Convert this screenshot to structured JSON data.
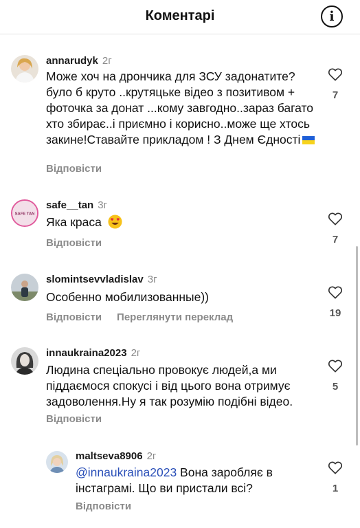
{
  "header": {
    "title": "Коментарі",
    "info_icon": "info-icon"
  },
  "comments": [
    {
      "user": "annarudyk",
      "time": "2г",
      "text": "Може хоч на дрончика для ЗСУ задонатите? було б круто ..крутяцьке відео з позитивом + фоточка за донат ...кому завгодно..зараз багато хто збирає..і приємно і корисно..може ще хтось закине!Ставайте прикладом ! З Днем Єдності",
      "emoji": "ukraine-flag",
      "reply_label": "Відповісти",
      "likes": "7"
    },
    {
      "user": "safe__tan",
      "time": "3г",
      "avatar_text": "SAFE TAN",
      "text": "Яка краса",
      "emoji": "heart-eyes",
      "reply_label": "Відповісти",
      "likes": "7"
    },
    {
      "user": "slomintsevvladislav",
      "time": "3г",
      "text": "Особенно мобилизованные))",
      "reply_label": "Відповісти",
      "translate_label": "Переглянути переклад",
      "likes": "19"
    },
    {
      "user": "innaukraina2023",
      "time": "2г",
      "text": "Людина спеціально провокує людей,а ми піддаємося спокусі  і від цього вона отримує задоволення.Ну я так розумію подібні відео.",
      "reply_label": "Відповісти",
      "likes": "5"
    }
  ],
  "reply": {
    "user": "maltseva8906",
    "time": "2г",
    "mention": "@innaukraina2023",
    "text": " Вона заробляє в інстаграмі. Що ви пристали всі?",
    "reply_label": "Відповісти",
    "likes": "1"
  },
  "colors": {
    "mention": "#2a4fb8",
    "muted": "#8a8a8a",
    "flag_blue": "#1f5fd6",
    "flag_yellow": "#f7d31c"
  }
}
